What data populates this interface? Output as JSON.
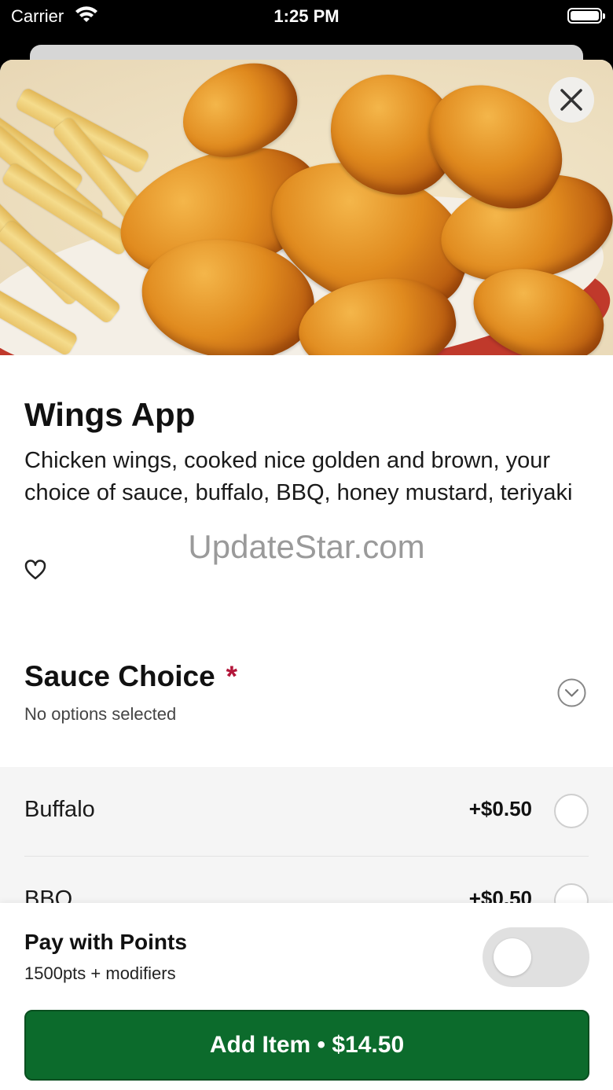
{
  "status_bar": {
    "carrier": "Carrier",
    "time": "1:25 PM",
    "wifi_icon": "wifi-icon",
    "battery_icon": "battery-full-icon"
  },
  "item": {
    "title": "Wings App",
    "description": "Chicken wings, cooked nice golden and brown, your choice of sauce, buffalo, BBQ, honey mustard, teriyaki",
    "favorite_icon": "heart-outline-icon",
    "close_icon": "close-icon"
  },
  "watermark": "UpdateStar.com",
  "sauce_section": {
    "title": "Sauce Choice",
    "required_marker": "*",
    "subtitle": "No options selected",
    "toggle_icon": "chevron-down-circle-icon",
    "options": [
      {
        "name": "Buffalo",
        "price": "+$0.50",
        "selected": false
      },
      {
        "name": "BBQ",
        "price": "+$0.50",
        "selected": false
      }
    ]
  },
  "points": {
    "title": "Pay with Points",
    "subtitle": "1500pts + modifiers",
    "enabled": false
  },
  "add_button": {
    "label": "Add Item • $14.50"
  },
  "colors": {
    "primary_button": "#0c6b2c",
    "required_star": "#b3163a"
  }
}
